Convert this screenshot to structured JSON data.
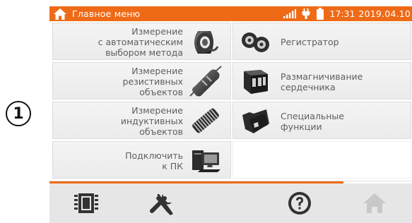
{
  "callout": {
    "number": "1"
  },
  "topbar": {
    "title": "Главное меню",
    "time": "17:31",
    "date": "2019.04.10",
    "icons": [
      "home-icon",
      "signal-icon",
      "plug-icon",
      "battery-icon"
    ]
  },
  "menu": {
    "left": [
      {
        "label": "Измерение\nс автоматическим\nвыбором метода",
        "icon": "auto-measure-icon"
      },
      {
        "label": "Измерение\nрезистивных\nобъектов",
        "icon": "resistor-icon"
      },
      {
        "label": "Измерение\nиндуктивных\nобъектов",
        "icon": "coil-icon"
      },
      {
        "label": "Подключить\nк ПК",
        "icon": "pc-connect-icon"
      }
    ],
    "right": [
      {
        "label": "Регистратор",
        "icon": "recorder-icon"
      },
      {
        "label": "Размагничивание\nсердечника",
        "icon": "demagnetize-icon"
      },
      {
        "label": "Специальные\nфункции",
        "icon": "special-functions-icon"
      }
    ]
  },
  "bottombar": {
    "buttons": [
      "memory-icon",
      "settings-icon",
      "help-icon",
      "home-icon"
    ]
  },
  "colors": {
    "accent": "#ef6a16",
    "tile": "#eeeeee",
    "text": "#5e5e5e",
    "bottom": "#e6e6e6"
  }
}
